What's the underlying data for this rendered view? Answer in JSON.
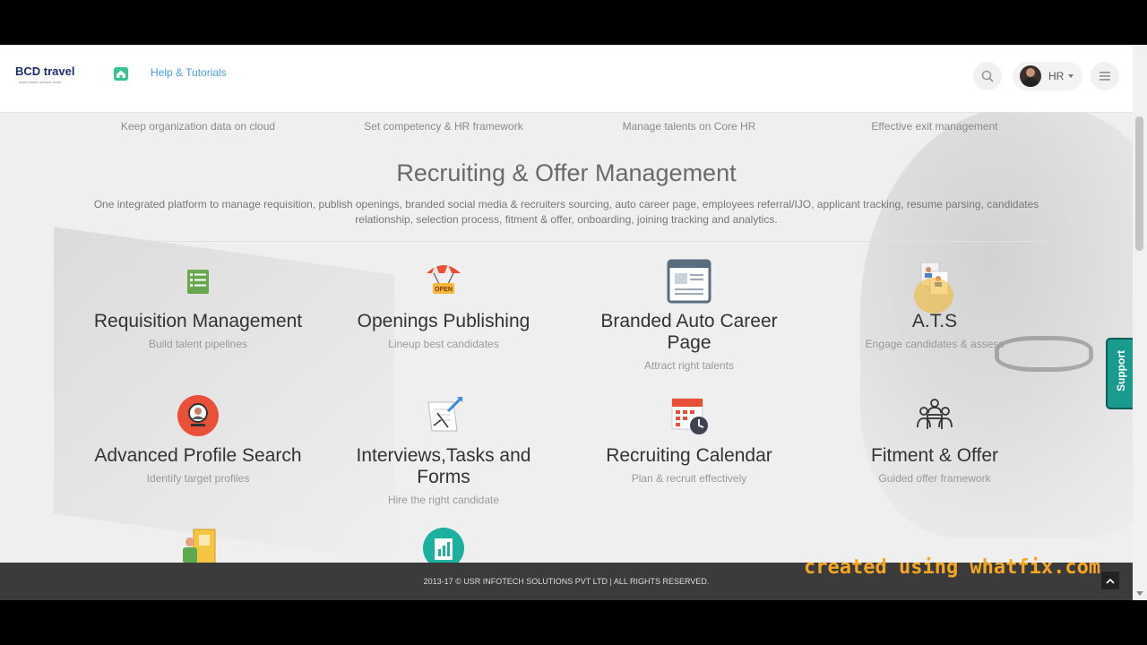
{
  "header": {
    "logo_text": "BCD travel",
    "logo_tagline": "travel smart. achieve more.",
    "help_link": "Help & Tutorials",
    "user": {
      "name": "HR"
    }
  },
  "prev_features": [
    "Keep organization data on cloud",
    "Set competency & HR framework",
    "Manage talents on Core HR",
    "Effective exit management"
  ],
  "section": {
    "title": "Recruiting & Offer Management",
    "description": "One integrated platform to manage requisition, publish openings, branded social media & recruiters sourcing, auto career page, employees referral/IJO, applicant tracking, resume parsing, candidates relationship, selection process, fitment & offer, onboarding, joining tracking and analytics."
  },
  "features": [
    {
      "title": "Requisition Management",
      "subtitle": "Build talent pipelines",
      "icon": "list-icon"
    },
    {
      "title": "Openings Publishing",
      "subtitle": "Lineup best candidates",
      "icon": "open-sign-icon"
    },
    {
      "title": "Branded Auto Career Page",
      "subtitle": "Attract right talents",
      "icon": "webpage-icon"
    },
    {
      "title": "A.T.S",
      "subtitle": "Engage candidates & assess",
      "icon": "applicant-documents-icon"
    },
    {
      "title": "Advanced Profile Search",
      "subtitle": "Identify target profiles",
      "icon": "profile-search-icon"
    },
    {
      "title": "Interviews,Tasks and Forms",
      "subtitle": "Hire the right candidate",
      "icon": "tasks-form-icon"
    },
    {
      "title": "Recruiting Calendar",
      "subtitle": "Plan & recruit effectively",
      "icon": "calendar-clock-icon"
    },
    {
      "title": "Fitment & Offer",
      "subtitle": "Guided offer framework",
      "icon": "team-meeting-icon"
    }
  ],
  "support_label": "Support",
  "footer": {
    "copyright": "2013-17 © USR INFOTECH SOLUTIONS PVT LTD | ALL RIGHTS RESERVED."
  },
  "watermark": "created using whatfix.com",
  "colors": {
    "accent_green": "#36c491",
    "link_blue": "#4a9fd8",
    "support_teal": "#1a9b8e",
    "watermark_orange": "#f5a623",
    "footer_bg": "#3b3b3b"
  }
}
